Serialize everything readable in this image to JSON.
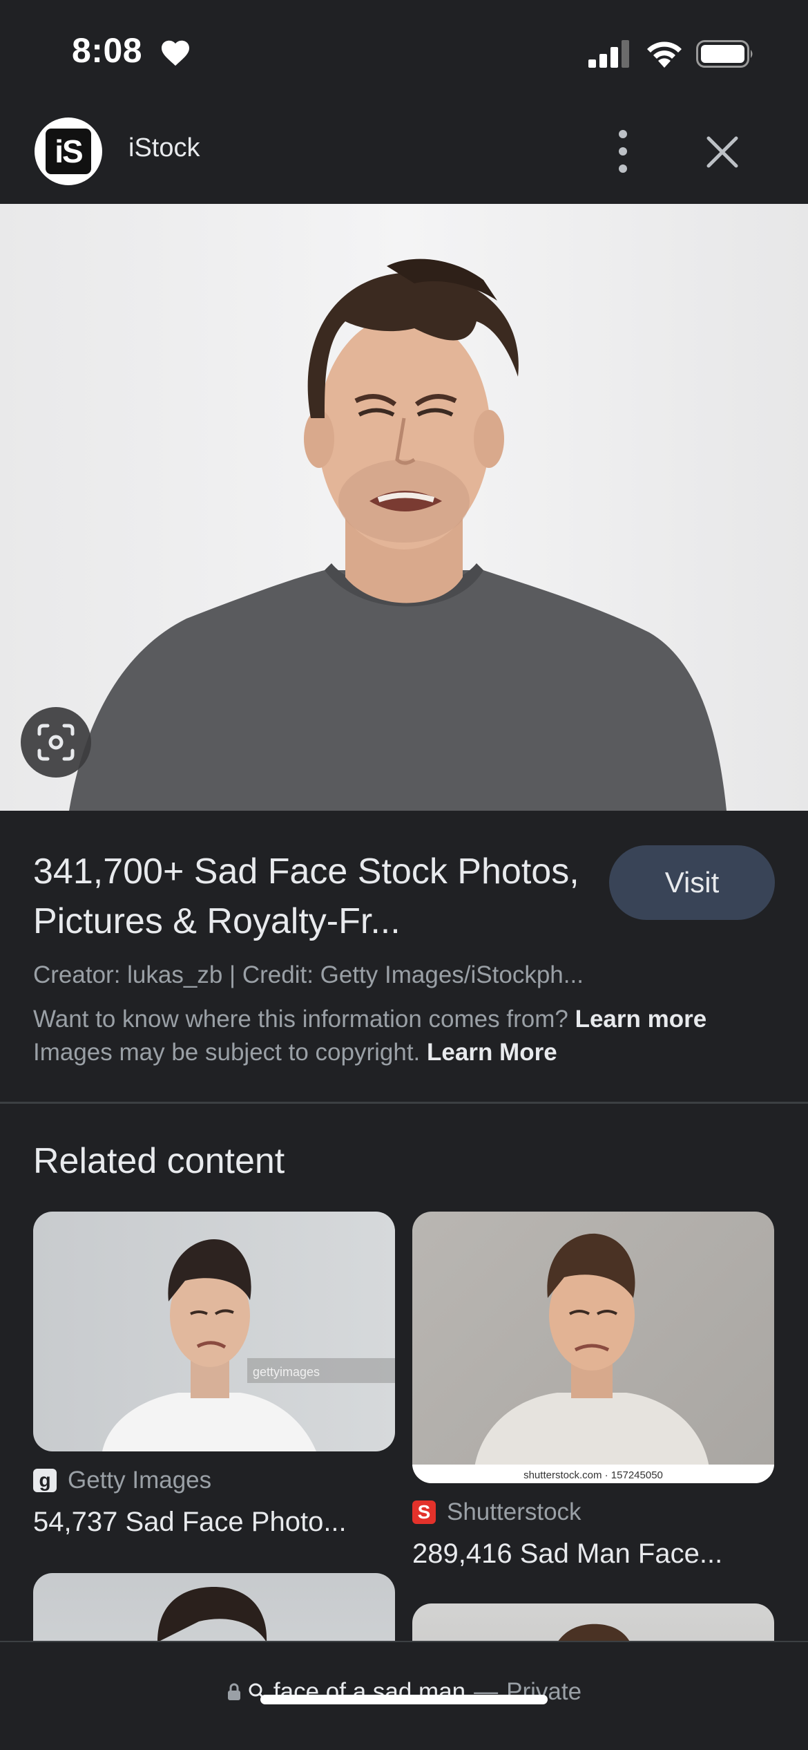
{
  "status_bar": {
    "time": "8:08"
  },
  "source": {
    "logo_text": "iS",
    "name": "iStock"
  },
  "result": {
    "title": "341,700+ Sad Face Stock Photos, Pictures & Royalty-Fr...",
    "visit_label": "Visit",
    "creator_line": "Creator: lukas_zb | Credit: Getty Images/iStockph...",
    "info_question": "Want to know where this information comes from?",
    "info_learn_more": "Learn more",
    "copyright_text": "Images may be subject to copyright.",
    "copyright_learn_more": "Learn More"
  },
  "related": {
    "title": "Related content",
    "cards": [
      {
        "source": "Getty Images",
        "favicon": "g",
        "title": "54,737 Sad Face Photo...",
        "watermark": "gettyimages"
      },
      {
        "source": "Shutterstock",
        "favicon": "S",
        "title": "289,416 Sad Man Face...",
        "watermark": "shutterstock.com · 157245050"
      }
    ]
  },
  "bottom_bar": {
    "query": "face of a sad man",
    "separator": "—",
    "mode": "Private"
  },
  "colors": {
    "background": "#202124",
    "visit_button": "#394457",
    "secondary_text": "#9aa0a6",
    "shutterstock_red": "#e3322b"
  },
  "icons": [
    "heart-icon",
    "signal-icon",
    "wifi-icon",
    "battery-icon",
    "more-vert-icon",
    "close-icon",
    "lens-icon",
    "lock-icon",
    "search-icon"
  ]
}
